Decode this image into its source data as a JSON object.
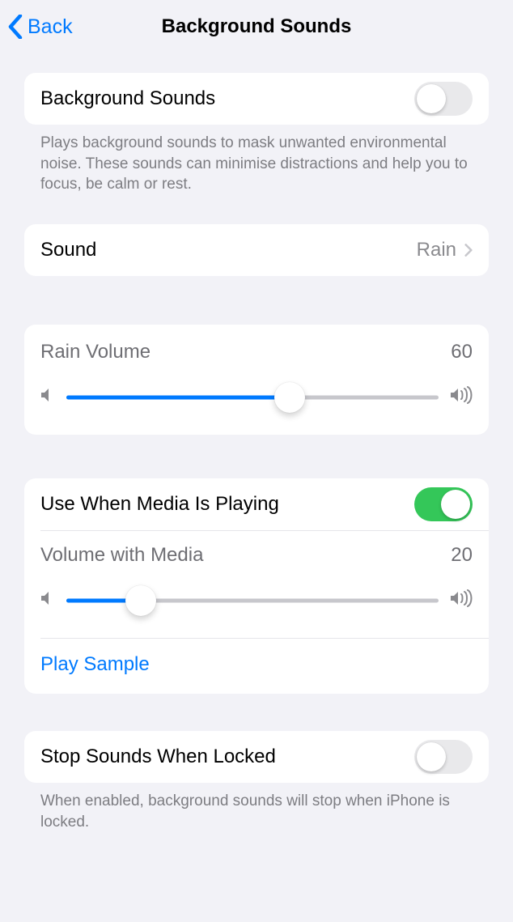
{
  "nav": {
    "back_label": "Back",
    "title": "Background Sounds"
  },
  "main_toggle": {
    "label": "Background Sounds",
    "enabled": false,
    "footer": "Plays background sounds to mask unwanted environmental noise. These sounds can minimise distractions and help you to focus, be calm or rest."
  },
  "sound_row": {
    "label": "Sound",
    "value": "Rain"
  },
  "volume": {
    "label": "Rain Volume",
    "value": 60
  },
  "media": {
    "toggle_label": "Use When Media Is Playing",
    "toggle_enabled": true,
    "slider_label": "Volume with Media",
    "slider_value": 20,
    "play_sample": "Play Sample"
  },
  "lock": {
    "label": "Stop Sounds When Locked",
    "enabled": false,
    "footer": "When enabled, background sounds will stop when iPhone is locked."
  }
}
